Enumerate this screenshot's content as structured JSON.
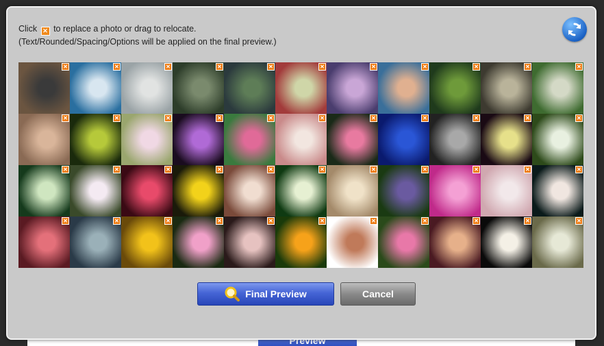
{
  "background": {
    "preview_label": "Preview"
  },
  "dialog": {
    "instructions": {
      "line1_before": "Click",
      "line1_after": "to replace a photo or drag to relocate.",
      "line2": "(Text/Rounded/Spacing/Options will be applied on the final preview.)"
    },
    "replace_glyph": "✕",
    "refresh_icon": "refresh-icon",
    "grid": {
      "columns": 11,
      "rows": 4,
      "tiles": [
        [
          "#6b5540",
          "#3a3a3a"
        ],
        [
          "#2a6fa0",
          "#d8e6f0"
        ],
        [
          "#9aa3a6",
          "#e1e3e2"
        ],
        [
          "#2d3d2a",
          "#7a8a6d"
        ],
        [
          "#2b3a3d",
          "#5e7d57"
        ],
        [
          "#a23b3b",
          "#cfd6a8"
        ],
        [
          "#4a3d6e",
          "#c9a6d6"
        ],
        [
          "#3a6f9a",
          "#e0b090"
        ],
        [
          "#1f3a1c",
          "#6e9a3a"
        ],
        [
          "#3d3a30",
          "#b9b39a"
        ],
        [
          "#3e6b30",
          "#d4d9c6"
        ],
        [
          "#8a6a54",
          "#d9b59a"
        ],
        [
          "#1a2a0c",
          "#b6c93a"
        ],
        [
          "#9aa66e",
          "#f0d8e4"
        ],
        [
          "#1a0c1f",
          "#b06ad6"
        ],
        [
          "#3a7a3e",
          "#e06a98"
        ],
        [
          "#c98a8a",
          "#f2e6e0"
        ],
        [
          "#1a2a18",
          "#e87aa0"
        ],
        [
          "#0a1a6e",
          "#2a56d6"
        ],
        [
          "#222222",
          "#a8a8a8"
        ],
        [
          "#1a0a14",
          "#e6e08a"
        ],
        [
          "#2d4a1a",
          "#e8f0e0"
        ],
        [
          "#153a1c",
          "#cfe6c0"
        ],
        [
          "#3a4a2a",
          "#f4eaf2"
        ],
        [
          "#3a0a14",
          "#e84a6a"
        ],
        [
          "#1a1a0a",
          "#f2d21a"
        ],
        [
          "#7a4a3a",
          "#f0ddd0"
        ],
        [
          "#0f3a12",
          "#e6f0d2"
        ],
        [
          "#a48a6a",
          "#f0e2c8"
        ],
        [
          "#1a3a12",
          "#6a5aa0"
        ],
        [
          "#c02a8a",
          "#f4a0d4"
        ],
        [
          "#d0a8b0",
          "#f2e8ea"
        ],
        [
          "#0a1a1a",
          "#f0e6e0"
        ],
        [
          "#5a1a22",
          "#e4707a"
        ],
        [
          "#2a3a48",
          "#9ab0b8"
        ],
        [
          "#6a4a0a",
          "#f2c21a"
        ],
        [
          "#1a2a12",
          "#f0a0c8"
        ],
        [
          "#2a1a1a",
          "#e6c2c0"
        ],
        [
          "#1a3a0a",
          "#f6a21a"
        ],
        [
          "#ffffff",
          "#c07a5a"
        ],
        [
          "#2a4a1a",
          "#e878a8"
        ],
        [
          "#4a1a22",
          "#e6b08a"
        ],
        [
          "#0a0a0a",
          "#f4f0e6"
        ],
        [
          "#6a6a4a",
          "#e6e8d6"
        ]
      ]
    },
    "buttons": {
      "final_preview": "Final Preview",
      "cancel": "Cancel"
    }
  }
}
